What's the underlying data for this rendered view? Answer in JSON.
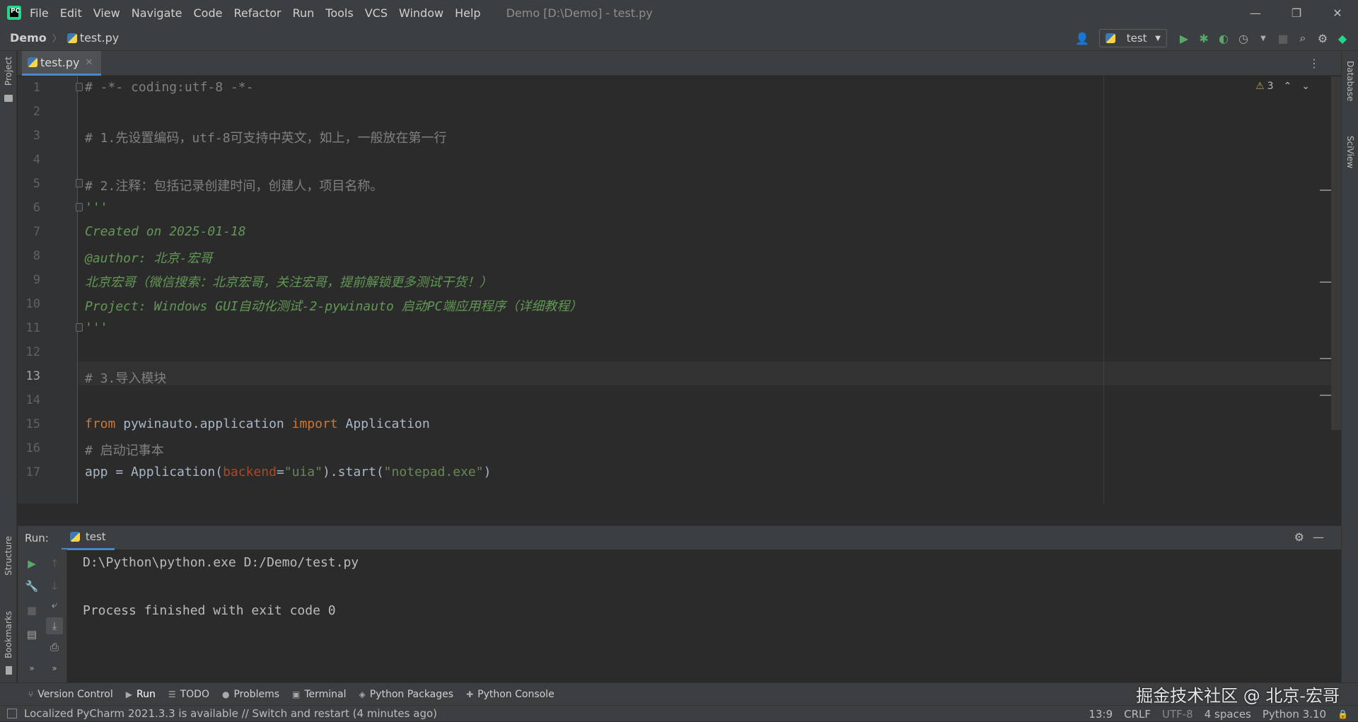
{
  "window": {
    "menu": [
      "File",
      "Edit",
      "View",
      "Navigate",
      "Code",
      "Refactor",
      "Run",
      "Tools",
      "VCS",
      "Window",
      "Help"
    ],
    "title": "Demo [D:\\Demo] - test.py",
    "controls": {
      "minimize": "—",
      "restore": "❐",
      "close": "✕"
    }
  },
  "navbar": {
    "project": "Demo",
    "file": "test.py",
    "run_config": "test"
  },
  "left_tools": {
    "project": "Project",
    "structure": "Structure",
    "bookmarks": "Bookmarks"
  },
  "right_tools": {
    "database": "Database",
    "sciview": "SciView"
  },
  "editor": {
    "tab_label": "test.py",
    "warning_count": "3",
    "line_numbers": [
      "1",
      "2",
      "3",
      "4",
      "5",
      "6",
      "7",
      "8",
      "9",
      "10",
      "11",
      "12",
      "13",
      "14",
      "15",
      "16",
      "17"
    ],
    "current_line": 13,
    "lines": {
      "l1": "# -*- coding:utf-8 -*-",
      "l3": "# 1.先设置编码，utf-8可支持中英文，如上，一般放在第一行",
      "l5": "# 2.注释：包括记录创建时间，创建人，项目名称。",
      "l6": "'''",
      "l7": "Created on 2025-01-18",
      "l8": "@author: 北京-宏哥",
      "l9": "北京宏哥（微信搜索：北京宏哥，关注宏哥，提前解锁更多测试干货！）",
      "l10": "Project: Windows GUI自动化测试-2-pywinauto 启动PC端应用程序（详细教程）",
      "l11": "'''",
      "l13": "# 3.导入模块",
      "l15_from": "from",
      "l15_mod": " pywinauto.application ",
      "l15_import": "import",
      "l15_cls": " Application",
      "l16": "# 启动记事本",
      "l17_a": "app = Application(",
      "l17_param": "backend",
      "l17_eq": "=",
      "l17_s1": "\"uia\"",
      "l17_b": ").start(",
      "l17_s2": "\"notepad.exe\"",
      "l17_c": ")"
    }
  },
  "run": {
    "label": "Run:",
    "tab": "test",
    "output": [
      "D:\\Python\\python.exe D:/Demo/test.py",
      "",
      "Process finished with exit code 0"
    ]
  },
  "bottom_tools": [
    "Version Control",
    "Run",
    "TODO",
    "Problems",
    "Terminal",
    "Python Packages",
    "Python Console"
  ],
  "watermark": "掘金技术社区 @ 北京-宏哥",
  "status": {
    "message": "Localized PyCharm 2021.3.3 is available // Switch and restart (4 minutes ago)",
    "position": "13:9",
    "line_sep": "CRLF",
    "encoding": "UTF-8",
    "indent": "4 spaces",
    "interpreter": "Python 3.10"
  },
  "colors": {
    "accent": "#4a88c7",
    "comment": "#808080",
    "docstring": "#629755",
    "keyword": "#cc7832",
    "string": "#6a8759",
    "run_green": "#59a869"
  }
}
